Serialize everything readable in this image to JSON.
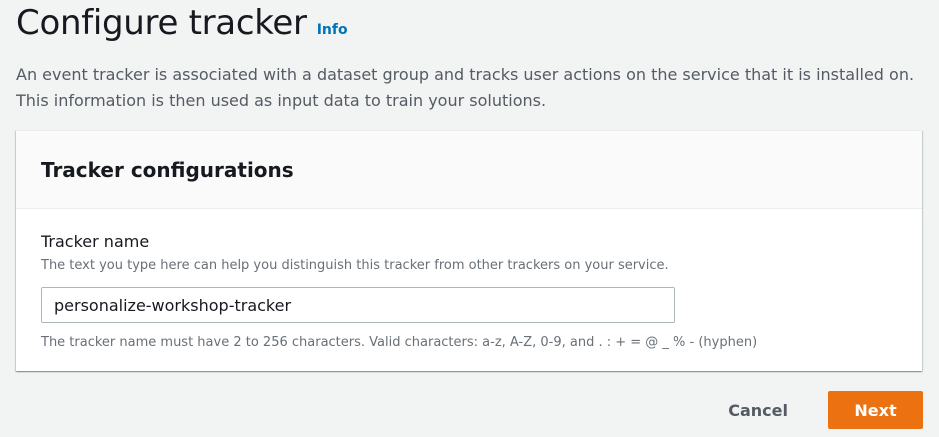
{
  "header": {
    "title": "Configure tracker",
    "info_label": "Info"
  },
  "description": "An event tracker is associated with a dataset group and tracks user actions on the service that it is installed on. This information is then used as input data to train your solutions.",
  "tracker_config": {
    "title": "Tracker configurations",
    "name_field": {
      "label": "Tracker name",
      "description": "The text you type here can help you distinguish this tracker from other trackers on your service.",
      "value": "personalize-workshop-tracker",
      "constraint": "The tracker name must have 2 to 256 characters. Valid characters: a-z, A-Z, 0-9, and . : + = @ _ % - (hyphen)"
    }
  },
  "actions": {
    "cancel_label": "Cancel",
    "next_label": "Next"
  },
  "colors": {
    "primary_button": "#ec7211",
    "link": "#0073bb",
    "background": "#f2f3f3"
  }
}
